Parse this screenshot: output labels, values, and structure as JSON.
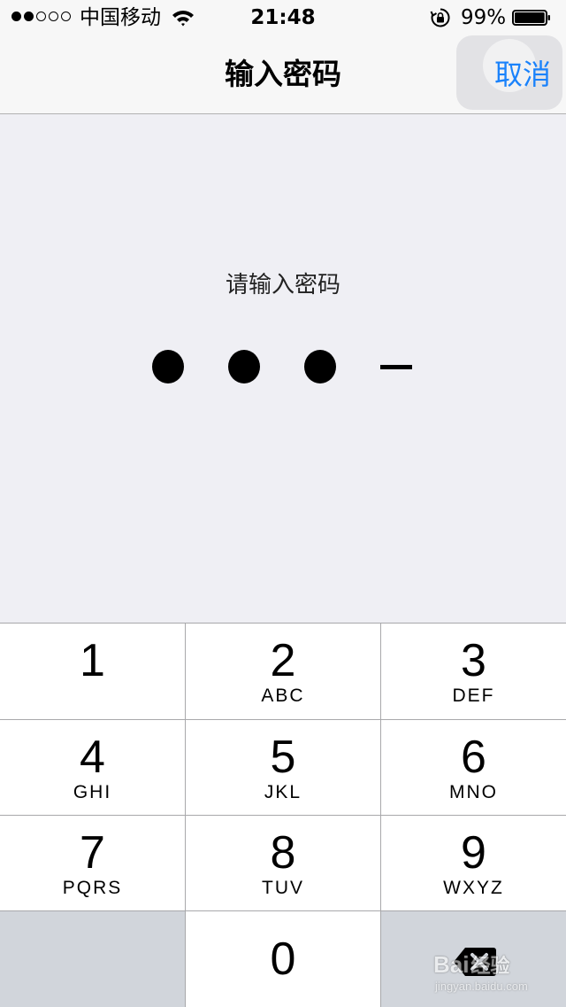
{
  "status_bar": {
    "signal_dots": [
      true,
      true,
      false,
      false,
      false
    ],
    "carrier": "中国移动",
    "time": "21:48",
    "battery_percent": "99%",
    "battery_level": 0.99,
    "icons": [
      "wifi-icon",
      "rotation-lock-icon",
      "battery-icon"
    ]
  },
  "nav": {
    "title": "输入密码",
    "cancel_label": "取消"
  },
  "passcode": {
    "prompt": "请输入密码",
    "digits_entered": 3,
    "digits_total": 4
  },
  "keypad": {
    "keys": [
      {
        "digit": "1",
        "letters": ""
      },
      {
        "digit": "2",
        "letters": "ABC"
      },
      {
        "digit": "3",
        "letters": "DEF"
      },
      {
        "digit": "4",
        "letters": "GHI"
      },
      {
        "digit": "5",
        "letters": "JKL"
      },
      {
        "digit": "6",
        "letters": "MNO"
      },
      {
        "digit": "7",
        "letters": "PQRS"
      },
      {
        "digit": "8",
        "letters": "TUV"
      },
      {
        "digit": "9",
        "letters": "WXYZ"
      },
      {
        "digit": "0",
        "letters": ""
      }
    ],
    "delete_icon": "backspace-icon"
  },
  "watermark": {
    "brand_prefix": "Bai",
    "brand_suffix": "经验",
    "url": "jingyan.baidu.com"
  },
  "colors": {
    "accent": "#1a82fb",
    "background": "#efeff4",
    "keypad_dark": "#d1d5db"
  }
}
